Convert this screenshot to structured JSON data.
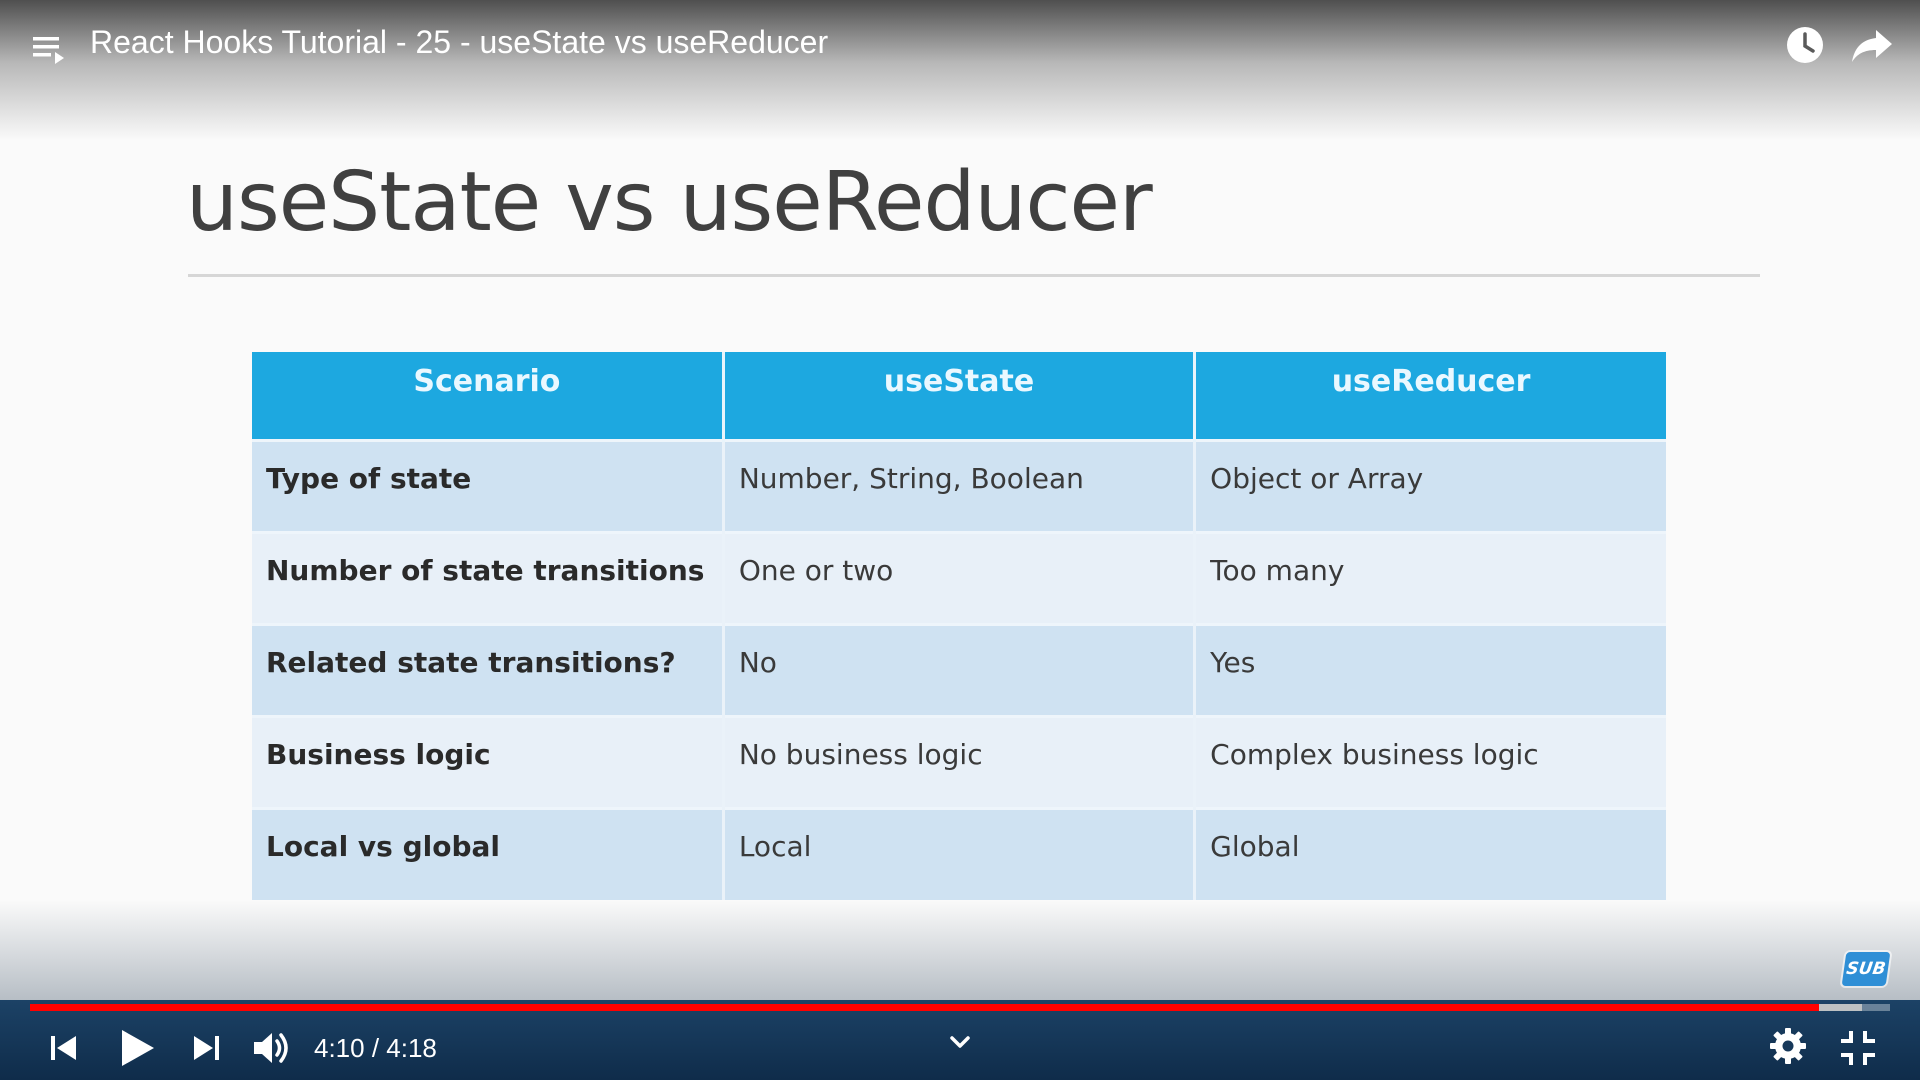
{
  "video": {
    "title": "React Hooks Tutorial - 25 - useState vs useReducer",
    "time": "4:10 / 4:18",
    "progress_fraction": 0.962,
    "buffered_end_fraction": 0.985
  },
  "slide": {
    "title": "useState vs useReducer",
    "table": {
      "headers": [
        "Scenario",
        "useState",
        "useReducer"
      ],
      "rows": [
        [
          "Type of state",
          "Number, String, Boolean",
          "Object or Array"
        ],
        [
          "Number of state transitions",
          "One or two",
          "Too many"
        ],
        [
          "Related state transitions?",
          "No",
          "Yes"
        ],
        [
          "Business logic",
          "No business logic",
          "Complex business logic"
        ],
        [
          "Local vs global",
          "Local",
          "Global"
        ]
      ]
    }
  },
  "badge": {
    "label": "SUB"
  },
  "colors": {
    "header": "#1da8e0",
    "row_odd": "#cfe2f2",
    "row_even": "#e8f0f8",
    "progress": "#ff0000",
    "control_bar": "#1c4266"
  },
  "icons": {
    "top": [
      "playlist-icon",
      "watch-later-icon",
      "share-icon"
    ],
    "controls": [
      "prev-icon",
      "play-icon",
      "next-icon",
      "volume-icon",
      "chevron-down-icon",
      "settings-icon",
      "exit-fullscreen-icon"
    ]
  }
}
